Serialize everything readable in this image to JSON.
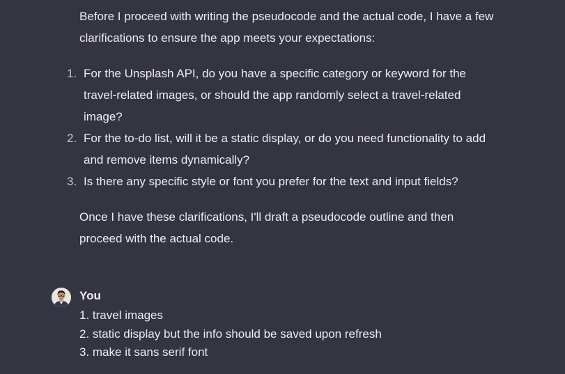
{
  "assistant": {
    "intro": "Before I proceed with writing the pseudocode and the actual code, I have a few clarifications to ensure the app meets your expectations:",
    "questions": [
      {
        "num": "1.",
        "text": "For the Unsplash API, do you have a specific category or keyword for the travel-related images, or should the app randomly select a travel-related image?"
      },
      {
        "num": "2.",
        "text": "For the to-do list, will it be a static display, or do you need functionality to add and remove items dynamically?"
      },
      {
        "num": "3.",
        "text": "Is there any specific style or font you prefer for the text and input fields?"
      }
    ],
    "outro": "Once I have these clarifications, I'll draft a pseudocode outline and then proceed with the actual code."
  },
  "user": {
    "name": "You",
    "avatar_icon": "user-avatar-icon",
    "lines": [
      "1. travel images",
      "2. static display but the info should be saved upon refresh",
      "3. make it sans serif font"
    ]
  },
  "colors": {
    "background": "#343541",
    "text": "#ececf1",
    "list_number": "#c5c5d2"
  }
}
